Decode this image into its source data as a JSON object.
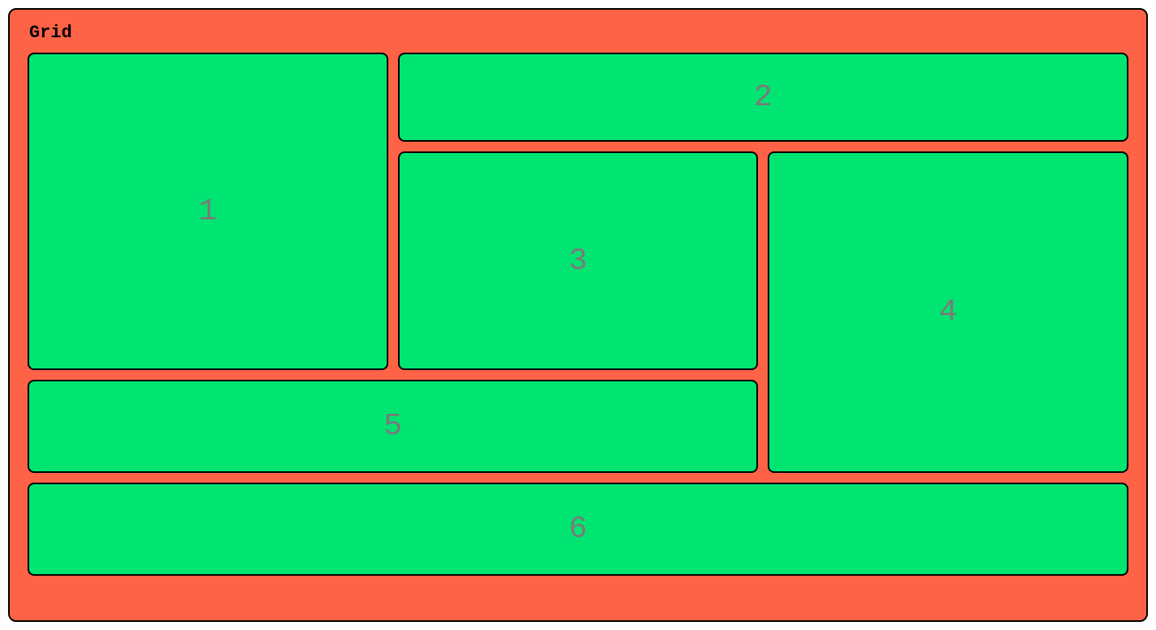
{
  "title": "Grid",
  "cells": {
    "c1": "1",
    "c2": "2",
    "c3": "3",
    "c4": "4",
    "c5": "5",
    "c6": "6"
  }
}
